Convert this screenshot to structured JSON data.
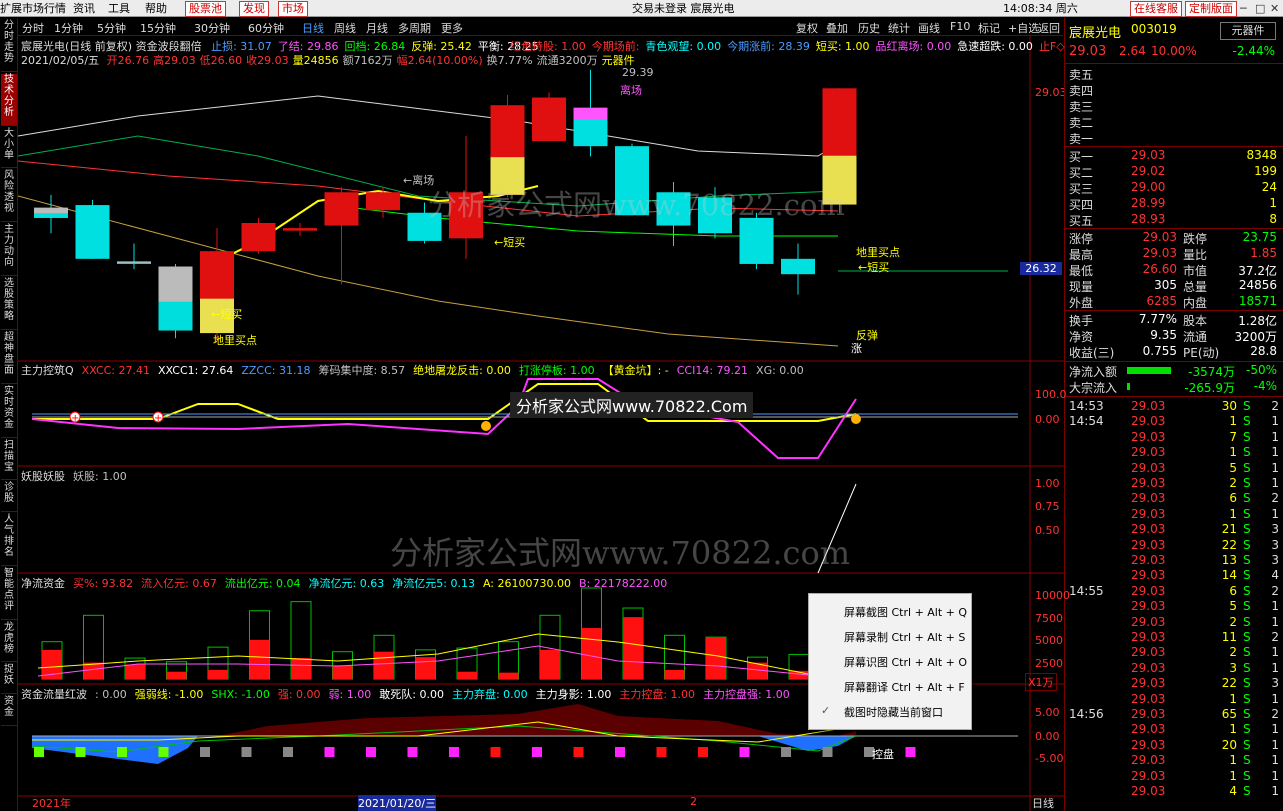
{
  "menubar": {
    "items": [
      "扩展市场行情",
      "资讯",
      "工具",
      "帮助"
    ],
    "buttons": [
      "股票池",
      "发现",
      "市场"
    ],
    "center": "交易未登录  宸展光电",
    "time": "14:08:34 周六",
    "right_btns": [
      "在线客服",
      "定制版面"
    ]
  },
  "toolbar": {
    "periods": [
      "分时",
      "1分钟",
      "5分钟",
      "15分钟",
      "30分钟",
      "60分钟",
      "日线",
      "周线",
      "月线",
      "多周期",
      "更多"
    ],
    "actions": [
      "复权",
      "叠加",
      "历史",
      "统计",
      "画线",
      "F10",
      "标记",
      "+自选",
      "返回"
    ]
  },
  "sidebar": [
    "分时走势",
    "技术分析",
    "大小单",
    "风险透视",
    "主力动向",
    "选股策略",
    "超神盘面",
    "实时资金",
    "扫描宝",
    "诊股",
    "人气排名",
    "智能点评",
    "龙虎榜",
    "捉妖",
    "资金"
  ],
  "main_chart": {
    "title": "宸展光电(日线 前复权)",
    "indicator": "资金波段翻倍",
    "params": [
      {
        "t": "止损: 31.07",
        "c": "#4d9cff"
      },
      {
        "t": "了结: 29.86",
        "c": "#ff55ff"
      },
      {
        "t": "回档: 26.84",
        "c": "#00ff00"
      },
      {
        "t": "反弹: 25.42",
        "c": "#ffff00"
      },
      {
        "t": "平衡: 28.25",
        "c": "#ffffff"
      }
    ],
    "params2": [
      {
        "t": "红色持股: 1.00",
        "c": "#ff3333"
      },
      {
        "t": "今期场前:",
        "c": "#ff3333"
      },
      {
        "t": "青色观望: 0.00",
        "c": "#00ffff"
      },
      {
        "t": "今期涨前: 28.39",
        "c": "#4d9cff"
      },
      {
        "t": "短买: 1.00",
        "c": "#ffff00"
      },
      {
        "t": "品红离场: 0.00",
        "c": "#ff55ff"
      },
      {
        "t": "急速超跌: 0.00",
        "c": "#ffffff"
      },
      {
        "t": "止F◇",
        "c": "#ff3333"
      }
    ],
    "ohlc_line": "2021/02/05/五",
    "ohlc": [
      {
        "t": "开26.76",
        "c": "#ff3333"
      },
      {
        "t": "高29.03",
        "c": "#ff3333"
      },
      {
        "t": "低26.60",
        "c": "#ff3333"
      },
      {
        "t": "收29.03",
        "c": "#ff3333"
      },
      {
        "t": "量24856",
        "c": "#ffff00"
      },
      {
        "t": "额7162万",
        "c": "#c0c0c0"
      },
      {
        "t": "幅2.64(10.00%)",
        "c": "#ff3333"
      },
      {
        "t": "换7.77%",
        "c": "#c0c0c0"
      },
      {
        "t": "流通3200万",
        "c": "#c0c0c0"
      },
      {
        "t": "元器件",
        "c": "#ffff00"
      }
    ],
    "price_label_top": "29.03",
    "price_label_cur": "26.32",
    "annotations": [
      {
        "t": "29.39",
        "c": "#c0c0c0"
      },
      {
        "t": "离场",
        "c": "#ff55ff"
      },
      {
        "t": "←离场",
        "c": "#c0c0c0"
      },
      {
        "t": "←短买",
        "c": "#ffff00"
      },
      {
        "t": "地里买点",
        "c": "#ffff00"
      },
      {
        "t": "←短买",
        "c": "#ffff00"
      },
      {
        "t": "←短买",
        "c": "#ffff00"
      },
      {
        "t": "地里买点",
        "c": "#ffff00"
      },
      {
        "t": "反弹",
        "c": "#ffff00"
      },
      {
        "t": "涨",
        "c": "#fff"
      }
    ]
  },
  "p2": {
    "name": "主力控筑Q",
    "params": [
      {
        "t": "XXCC: 27.41",
        "c": "#ff3333"
      },
      {
        "t": "XXCC1: 27.64",
        "c": "#ffffff"
      },
      {
        "t": "ZZCC: 31.18",
        "c": "#4d9cff"
      },
      {
        "t": "筹码集中度: 8.57",
        "c": "#c0c0c0"
      },
      {
        "t": "绝地屠龙反击: 0.00",
        "c": "#ffff00"
      },
      {
        "t": "打涨停板: 1.00",
        "c": "#00ff00"
      },
      {
        "t": "【黄金坑】: -",
        "c": "#ffff00"
      },
      {
        "t": "CCI14: 79.21",
        "c": "#ff55ff"
      },
      {
        "t": "XG: 0.00",
        "c": "#c0c0c0"
      }
    ],
    "axis": [
      "100.0",
      "0.00"
    ]
  },
  "p3": {
    "name": "妖股妖股",
    "params": [
      {
        "t": "妖股: 1.00",
        "c": "#c0c0c0"
      }
    ],
    "axis": [
      "1.00",
      "0.75",
      "0.50"
    ]
  },
  "p4": {
    "name": "净流资金",
    "params": [
      {
        "t": "买%: 93.82",
        "c": "#ff3333"
      },
      {
        "t": "流入亿元: 0.67",
        "c": "#ff3333"
      },
      {
        "t": "流出亿元: 0.04",
        "c": "#00ff00"
      },
      {
        "t": "净流亿元: 0.63",
        "c": "#00ffff"
      },
      {
        "t": "净流亿元5: 0.13",
        "c": "#00ffff"
      },
      {
        "t": "A: 26100730.00",
        "c": "#ffff00"
      },
      {
        "t": "B: 22178222.00",
        "c": "#ff55ff"
      }
    ],
    "axis": [
      "10000",
      "7500",
      "5000",
      "2500"
    ],
    "unit": "X1万"
  },
  "p5": {
    "name": "资金流量红波",
    "params": [
      {
        "t": ": 0.00",
        "c": "#c0c0c0"
      },
      {
        "t": "强弱线: -1.00",
        "c": "#ffff00"
      },
      {
        "t": "SHX: -1.00",
        "c": "#00ff00"
      },
      {
        "t": "强: 0.00",
        "c": "#ff3333"
      },
      {
        "t": "弱: 1.00",
        "c": "#ff55ff"
      },
      {
        "t": "敢死队: 0.00",
        "c": "#ffffff"
      },
      {
        "t": "主力弃盘: 0.00",
        "c": "#00ffff"
      },
      {
        "t": "主力身影: 1.00",
        "c": "#ffffff"
      },
      {
        "t": "主力控盘: 1.00",
        "c": "#ff3333"
      },
      {
        "t": "主力控盘强: 1.00",
        "c": "#ff55ff"
      }
    ],
    "axis": [
      "5.00",
      "0.00",
      "-5.00"
    ],
    "tag": "控盘"
  },
  "xaxis": {
    "labels": [
      "2021年",
      "2021/01/20/三",
      "2"
    ],
    "right": "日线"
  },
  "watermark": "分析家公式网www.70822.com",
  "watermark_box": "分析家公式网www.70822.Com",
  "context_menu": [
    "屏幕截图 Ctrl + Alt + Q",
    "屏幕录制 Ctrl + Alt + S",
    "屏幕识图 Ctrl + Alt + O",
    "屏幕翻译 Ctrl + Alt + F",
    "截图时隐藏当前窗口"
  ],
  "quote": {
    "name": "宸展光电",
    "code": "003019",
    "sector_btn": "元器件",
    "sector_pct": "-2.44%",
    "price": "29.03",
    "change": "2.64",
    "pct": "10.00%",
    "sells": [
      "卖五",
      "卖四",
      "卖三",
      "卖二",
      "卖一"
    ],
    "buys": [
      {
        "l": "买一",
        "p": "29.03",
        "v": "8348"
      },
      {
        "l": "买二",
        "p": "29.02",
        "v": "199"
      },
      {
        "l": "买三",
        "p": "29.00",
        "v": "24"
      },
      {
        "l": "买四",
        "p": "28.99",
        "v": "1"
      },
      {
        "l": "买五",
        "p": "28.93",
        "v": "8"
      }
    ],
    "stats": [
      {
        "a": "涨停",
        "av": "29.03",
        "ac": "#ff3333",
        "b": "跌停",
        "bv": "23.75",
        "bc": "#00ff00"
      },
      {
        "a": "最高",
        "av": "29.03",
        "ac": "#ff3333",
        "b": "量比",
        "bv": "1.85",
        "bc": "#ff3333"
      },
      {
        "a": "最低",
        "av": "26.60",
        "ac": "#ff3333",
        "b": "市值",
        "bv": "37.2亿",
        "bc": "#ffffff"
      },
      {
        "a": "现量",
        "av": "305",
        "ac": "#ffffff",
        "b": "总量",
        "bv": "24856",
        "bc": "#ffffff"
      },
      {
        "a": "外盘",
        "av": "6285",
        "ac": "#ff3333",
        "b": "内盘",
        "bv": "18571",
        "bc": "#00ff00"
      }
    ],
    "stats2": [
      {
        "a": "换手",
        "av": "7.77%",
        "ac": "#ffffff",
        "b": "股本",
        "bv": "1.28亿",
        "bc": "#ffffff"
      },
      {
        "a": "净资",
        "av": "9.35",
        "ac": "#ffffff",
        "b": "流通",
        "bv": "3200万",
        "bc": "#ffffff"
      },
      {
        "a": "收益(三)",
        "av": "0.755",
        "ac": "#ffffff",
        "b": "PE(动)",
        "bv": "28.8",
        "bc": "#ffffff"
      }
    ],
    "flow": [
      {
        "l": "净流入额",
        "v": "-3574万",
        "p": "-50%"
      },
      {
        "l": "大宗流入",
        "v": "-265.9万",
        "p": "-4%"
      }
    ],
    "ticks": [
      {
        "t": "14:53",
        "p": "29.03",
        "v": "30",
        "s": "S",
        "n": "2"
      },
      {
        "t": "14:54",
        "p": "29.03",
        "v": "1",
        "s": "S",
        "n": "1"
      },
      {
        "t": "",
        "p": "29.03",
        "v": "7",
        "s": "S",
        "n": "1"
      },
      {
        "t": "",
        "p": "29.03",
        "v": "1",
        "s": "S",
        "n": "1"
      },
      {
        "t": "",
        "p": "29.03",
        "v": "5",
        "s": "S",
        "n": "1"
      },
      {
        "t": "",
        "p": "29.03",
        "v": "2",
        "s": "S",
        "n": "1"
      },
      {
        "t": "",
        "p": "29.03",
        "v": "6",
        "s": "S",
        "n": "2"
      },
      {
        "t": "",
        "p": "29.03",
        "v": "1",
        "s": "S",
        "n": "1"
      },
      {
        "t": "",
        "p": "29.03",
        "v": "21",
        "s": "S",
        "n": "3"
      },
      {
        "t": "",
        "p": "29.03",
        "v": "22",
        "s": "S",
        "n": "3"
      },
      {
        "t": "",
        "p": "29.03",
        "v": "13",
        "s": "S",
        "n": "3"
      },
      {
        "t": "",
        "p": "29.03",
        "v": "14",
        "s": "S",
        "n": "4"
      },
      {
        "t": "14:55",
        "p": "29.03",
        "v": "6",
        "s": "S",
        "n": "2"
      },
      {
        "t": "",
        "p": "29.03",
        "v": "5",
        "s": "S",
        "n": "1"
      },
      {
        "t": "",
        "p": "29.03",
        "v": "2",
        "s": "S",
        "n": "1"
      },
      {
        "t": "",
        "p": "29.03",
        "v": "11",
        "s": "S",
        "n": "2"
      },
      {
        "t": "",
        "p": "29.03",
        "v": "2",
        "s": "S",
        "n": "1"
      },
      {
        "t": "",
        "p": "29.03",
        "v": "3",
        "s": "S",
        "n": "1"
      },
      {
        "t": "",
        "p": "29.03",
        "v": "22",
        "s": "S",
        "n": "3"
      },
      {
        "t": "",
        "p": "29.03",
        "v": "1",
        "s": "S",
        "n": "1"
      },
      {
        "t": "14:56",
        "p": "29.03",
        "v": "65",
        "s": "S",
        "n": "2"
      },
      {
        "t": "",
        "p": "29.03",
        "v": "1",
        "s": "S",
        "n": "1"
      },
      {
        "t": "",
        "p": "29.03",
        "v": "20",
        "s": "S",
        "n": "1"
      },
      {
        "t": "",
        "p": "29.03",
        "v": "1",
        "s": "S",
        "n": "1"
      },
      {
        "t": "",
        "p": "29.03",
        "v": "1",
        "s": "S",
        "n": "1"
      },
      {
        "t": "",
        "p": "29.03",
        "v": "4",
        "s": "S",
        "n": "1"
      }
    ]
  },
  "candles": [
    {
      "o": 26.7,
      "h": 26.95,
      "l": 26.2,
      "c": 26.5,
      "k": "g"
    },
    {
      "o": 26.75,
      "h": 26.85,
      "l": 25.7,
      "c": 25.7,
      "k": "c"
    },
    {
      "o": 25.65,
      "h": 26.0,
      "l": 25.5,
      "c": 25.6,
      "k": "g"
    },
    {
      "o": 25.55,
      "h": 25.6,
      "l": 24.15,
      "c": 24.3,
      "k": "g"
    },
    {
      "o": 24.25,
      "h": 26.3,
      "l": 24.1,
      "c": 25.85,
      "k": "r"
    },
    {
      "o": 25.85,
      "h": 26.5,
      "l": 25.8,
      "c": 26.4,
      "k": "r"
    },
    {
      "o": 26.25,
      "h": 26.4,
      "l": 26.15,
      "c": 26.3,
      "k": "r"
    },
    {
      "o": 26.35,
      "h": 27.1,
      "l": 25.2,
      "c": 27.0,
      "k": "r"
    },
    {
      "o": 26.65,
      "h": 27.1,
      "l": 26.5,
      "c": 27.0,
      "k": "r"
    },
    {
      "o": 26.6,
      "h": 26.8,
      "l": 26.0,
      "c": 26.05,
      "k": "c"
    },
    {
      "o": 26.1,
      "h": 28.1,
      "l": 25.7,
      "c": 27.0,
      "k": "r"
    },
    {
      "o": 28.7,
      "h": 28.9,
      "l": 26.9,
      "c": 26.95,
      "k": "r"
    },
    {
      "o": 28.85,
      "h": 28.95,
      "l": 28.0,
      "c": 28.0,
      "k": "r"
    },
    {
      "o": 28.65,
      "h": 29.39,
      "l": 27.7,
      "c": 27.9,
      "k": "m"
    },
    {
      "o": 27.9,
      "h": 27.95,
      "l": 26.55,
      "c": 26.55,
      "k": "c"
    },
    {
      "o": 27.0,
      "h": 27.2,
      "l": 25.95,
      "c": 26.35,
      "k": "c"
    },
    {
      "o": 26.9,
      "h": 27.1,
      "l": 26.1,
      "c": 26.2,
      "k": "c"
    },
    {
      "o": 26.5,
      "h": 26.6,
      "l": 25.5,
      "c": 25.6,
      "k": "c"
    },
    {
      "o": 25.7,
      "h": 26.0,
      "l": 25.0,
      "c": 25.4,
      "k": "c"
    },
    {
      "o": 26.76,
      "h": 29.03,
      "l": 26.6,
      "c": 29.03,
      "k": "r"
    }
  ],
  "p4_bars": [
    {
      "a": 3200,
      "b": 4100
    },
    {
      "a": 1800,
      "b": 7000
    },
    {
      "a": 1600,
      "b": 2300
    },
    {
      "a": 800,
      "b": 1900
    },
    {
      "a": 1000,
      "b": 3500
    },
    {
      "a": 4300,
      "b": 7500
    },
    {
      "a": 2300,
      "b": 8500
    },
    {
      "a": 1500,
      "b": 3000
    },
    {
      "a": 3000,
      "b": 4800
    },
    {
      "a": 2400,
      "b": 3200
    },
    {
      "a": 800,
      "b": 3400
    },
    {
      "a": 700,
      "b": 4100
    },
    {
      "a": 3200,
      "b": 7000
    },
    {
      "a": 5600,
      "b": 10000
    },
    {
      "a": 6800,
      "b": 7800
    },
    {
      "a": 1000,
      "b": 4800
    },
    {
      "a": 4600,
      "b": 4600
    },
    {
      "a": 1800,
      "b": 2400
    },
    {
      "a": 900,
      "b": 2700
    },
    {
      "a": 1200,
      "b": 2900
    }
  ],
  "p5_marks": [
    "g",
    "g",
    "g",
    "g",
    "w",
    "w",
    "w",
    "m",
    "m",
    "m",
    "m",
    "r",
    "m",
    "r",
    "m",
    "r",
    "r",
    "m",
    "w",
    "w",
    "w",
    "m"
  ]
}
